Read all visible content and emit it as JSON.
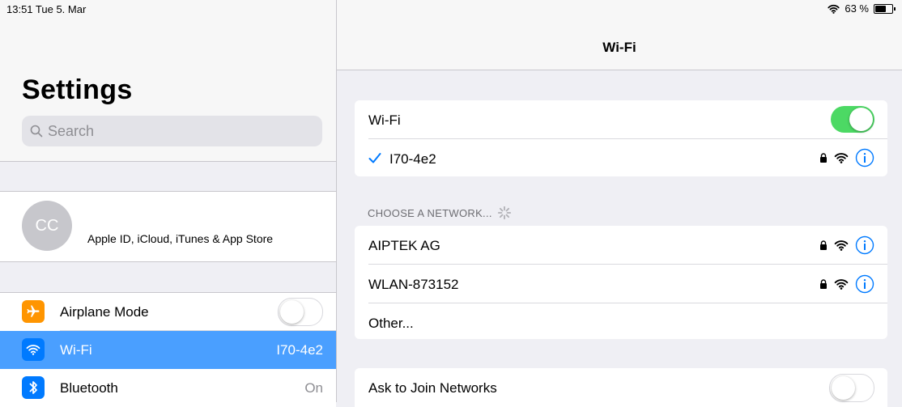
{
  "status_bar": {
    "time_date": "13:51  Tue 5. Mar",
    "battery_text": "63 %",
    "battery_level": 0.63
  },
  "sidebar": {
    "title": "Settings",
    "search_placeholder": "Search",
    "profile": {
      "initials": "CC",
      "subtitle": "Apple ID, iCloud, iTunes & App Store"
    },
    "items": [
      {
        "label": "Airplane Mode",
        "value": "",
        "icon": "airplane-icon",
        "icon_color": "#ff9500",
        "toggle": "off"
      },
      {
        "label": "Wi-Fi",
        "value": "I70-4e2",
        "icon": "wifi-icon",
        "icon_color": "#007aff",
        "selected": true
      },
      {
        "label": "Bluetooth",
        "value": "On",
        "icon": "bluetooth-icon",
        "icon_color": "#007aff"
      }
    ]
  },
  "detail": {
    "title": "Wi-Fi",
    "wifi_label": "Wi-Fi",
    "wifi_toggle": "on",
    "connected_network": "I70-4e2",
    "choose_header": "CHOOSE A NETWORK...",
    "networks": [
      {
        "name": "AIPTEK AG",
        "locked": true
      },
      {
        "name": "WLAN-873152",
        "locked": true
      }
    ],
    "other_label": "Other...",
    "ask_label": "Ask to Join Networks",
    "ask_toggle": "off"
  },
  "colors": {
    "accent": "#007aff",
    "toggle_on": "#4cd964",
    "selected_row": "#4a9fff"
  }
}
